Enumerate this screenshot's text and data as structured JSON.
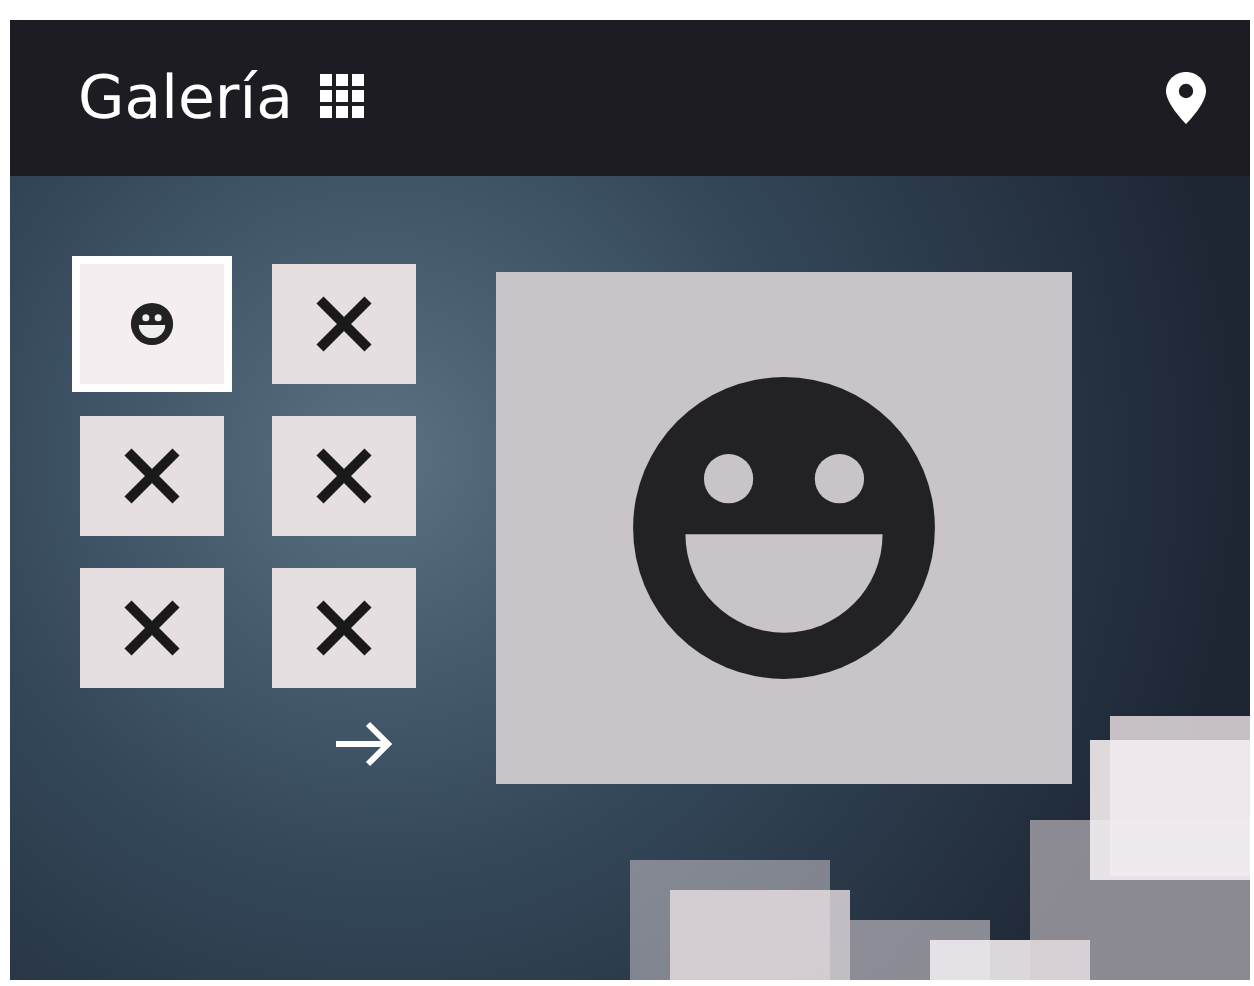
{
  "header": {
    "title": "Galería"
  },
  "thumbnails": [
    {
      "kind": "smiley",
      "selected": true
    },
    {
      "kind": "cross",
      "selected": false
    },
    {
      "kind": "cross",
      "selected": false
    },
    {
      "kind": "cross",
      "selected": false
    },
    {
      "kind": "cross",
      "selected": false
    },
    {
      "kind": "cross",
      "selected": false
    }
  ],
  "preview": {
    "kind": "smiley"
  }
}
